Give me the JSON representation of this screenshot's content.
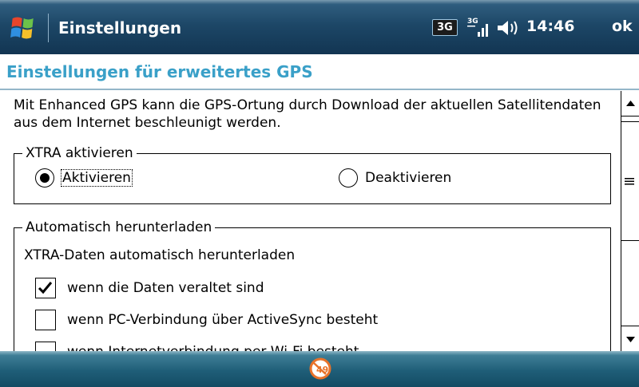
{
  "titlebar": {
    "title": "Einstellungen",
    "network_badge": "3G",
    "time": "14:46",
    "ok_label": "ok",
    "icons": [
      "windows-start-icon",
      "3g-icon",
      "signal-strength-icon",
      "speaker-icon"
    ]
  },
  "page": {
    "title": "Einstellungen für erweitertes GPS",
    "description": "Mit Enhanced GPS kann die GPS-Ortung durch Download der aktuellen Satellitendaten aus dem Internet beschleunigt werden."
  },
  "xtra_group": {
    "legend": "XTRA aktivieren",
    "options": [
      {
        "label": "Aktivieren",
        "selected": true
      },
      {
        "label": "Deaktivieren",
        "selected": false
      }
    ]
  },
  "download_group": {
    "legend": "Automatisch herunterladen",
    "sub_label": "XTRA-Daten automatisch herunterladen",
    "options": [
      {
        "label": "wenn die Daten veraltet sind",
        "checked": true
      },
      {
        "label": "wenn PC-Verbindung über ActiveSync besteht",
        "checked": false
      },
      {
        "label": "wenn Internetverbindung per Wi-Fi besteht",
        "checked": false
      }
    ]
  },
  "colors": {
    "titlebar": "#1d4767",
    "heading": "#3aa0c8",
    "bottombar": "#1f5e78",
    "keyboard_icon": "#e8722a"
  },
  "bottombar": {
    "icon": "keyboard-icon"
  }
}
